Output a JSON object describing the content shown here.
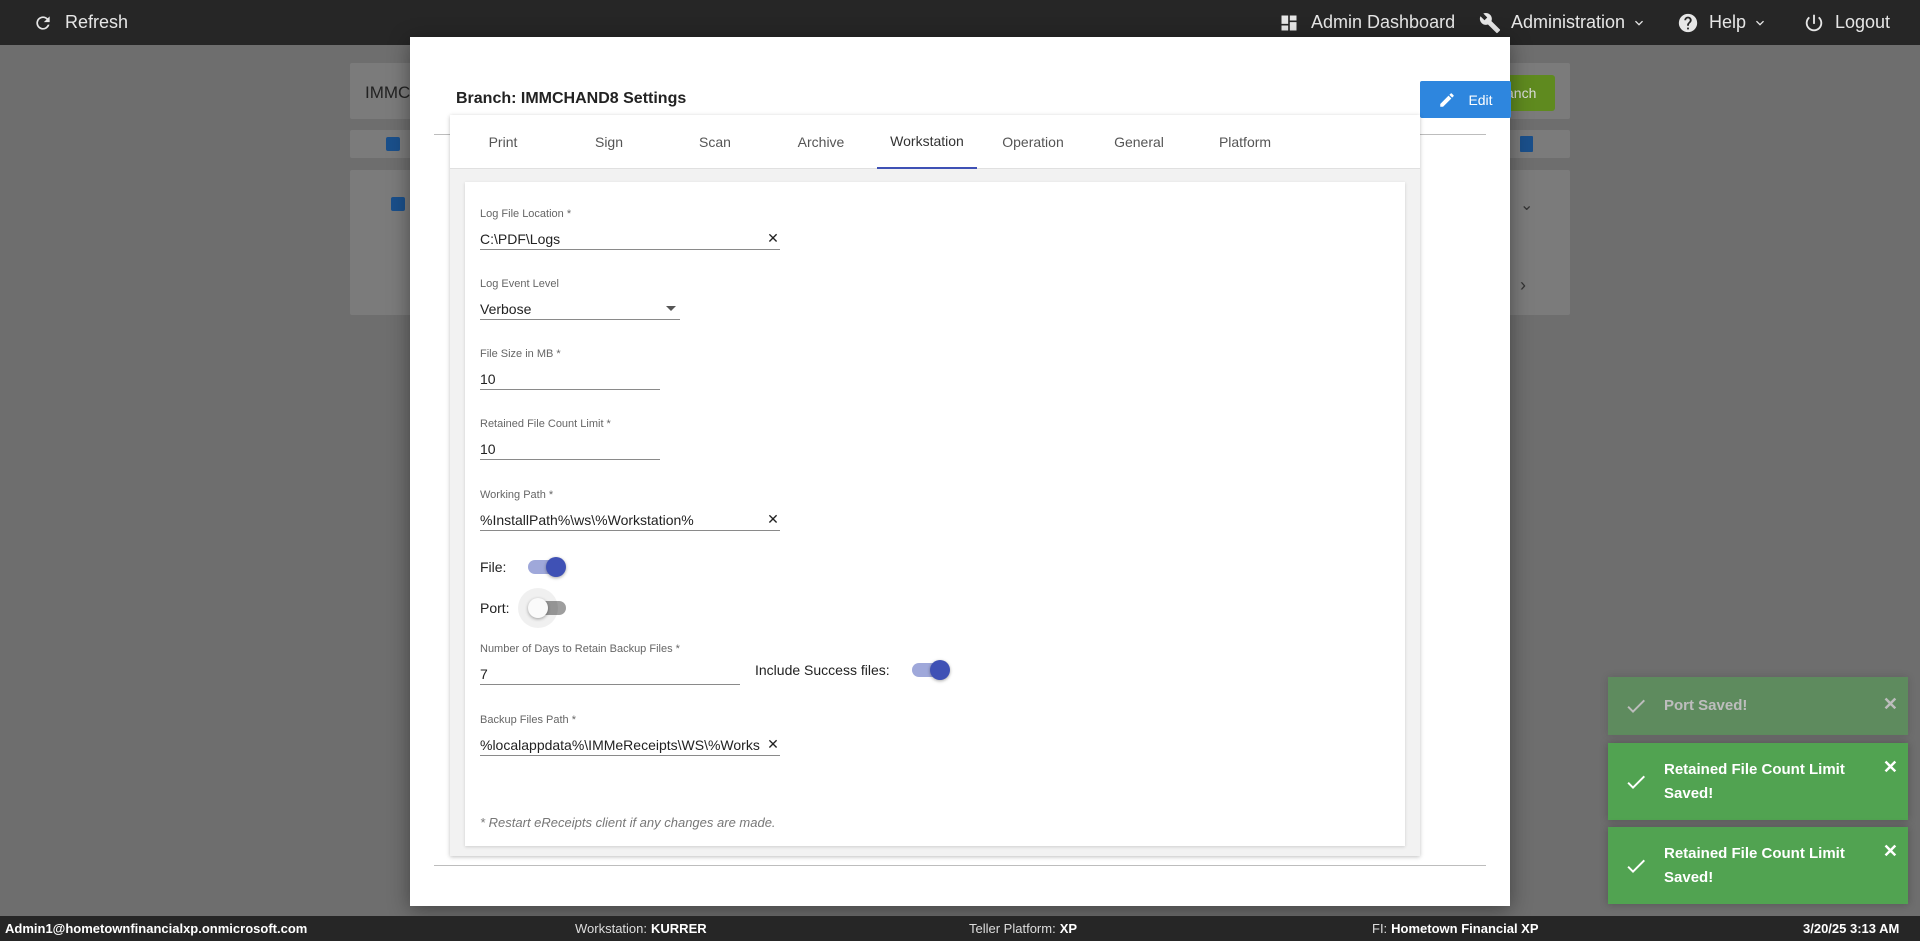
{
  "topbar": {
    "refresh": "Refresh",
    "admin_dashboard": "Admin Dashboard",
    "administration": "Administration",
    "help": "Help",
    "logout": "Logout"
  },
  "background": {
    "search_text": "IMMCH",
    "add_branch_label": "anch"
  },
  "modal": {
    "title": "Branch: IMMCHAND8 Settings",
    "edit_label": "Edit",
    "tabs": [
      {
        "label": "Print"
      },
      {
        "label": "Sign"
      },
      {
        "label": "Scan"
      },
      {
        "label": "Archive"
      },
      {
        "label": "Workstation"
      },
      {
        "label": "Operation"
      },
      {
        "label": "General"
      },
      {
        "label": "Platform"
      }
    ],
    "active_tab": "Workstation",
    "form": {
      "log_file_location": {
        "label": "Log File Location *",
        "value": "C:\\PDF\\Logs"
      },
      "log_event_level": {
        "label": "Log Event Level",
        "value": "Verbose"
      },
      "file_size": {
        "label": "File Size in MB *",
        "value": "10"
      },
      "retained_count": {
        "label": "Retained File Count Limit *",
        "value": "10"
      },
      "working_path": {
        "label": "Working Path *",
        "value": "%InstallPath%\\ws\\%Workstation%"
      },
      "file_toggle": {
        "label": "File:",
        "on": true
      },
      "port_toggle": {
        "label": "Port:",
        "on": false
      },
      "backup_days": {
        "label": "Number of Days to Retain Backup Files *",
        "value": "7"
      },
      "include_success": {
        "label": "Include Success files:",
        "on": true
      },
      "backup_path": {
        "label": "Backup Files Path *",
        "value": "%localappdata%\\IMMeReceipts\\WS\\%Works"
      },
      "note": "* Restart eReceipts client if any changes are made."
    }
  },
  "toasts": [
    {
      "message": "Port Saved!",
      "faded": true
    },
    {
      "message": "Retained File Count Limit Saved!",
      "faded": false
    },
    {
      "message": "Retained File Count Limit Saved!",
      "faded": false
    }
  ],
  "statusbar": {
    "user": "Admin1@hometownfinancialxp.onmicrosoft.com",
    "workstation_key": "Workstation:",
    "workstation_val": "KURRER",
    "platform_key": "Teller Platform:",
    "platform_val": "XP",
    "fi_key": "FI:",
    "fi_val": "Hometown Financial XP",
    "datetime": "3/20/25 3:13 AM"
  },
  "colors": {
    "accent": "#3f51b5",
    "edit_button": "#2e86de",
    "toast_success": "#51a351",
    "topbar": "#262626"
  }
}
